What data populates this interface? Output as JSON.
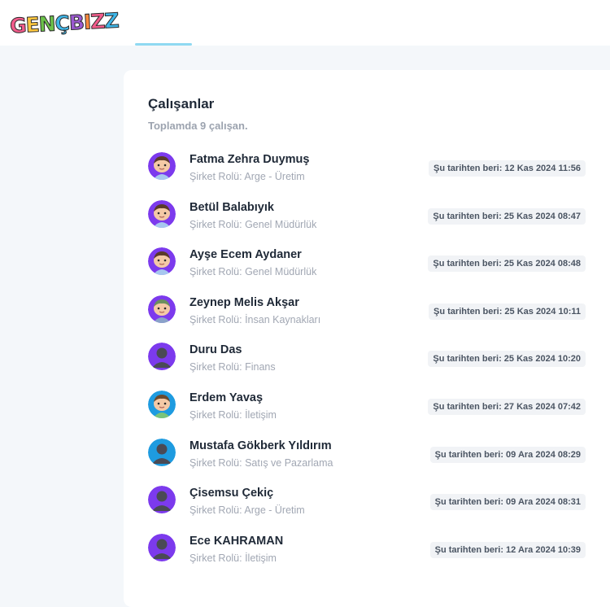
{
  "brand": {
    "logo_text": "GENÇBIZZ",
    "logo_colors": [
      "#f25c8b",
      "#ffc83d",
      "#6cc24a",
      "#3fb6e8",
      "#9b59d0",
      "#ff8a3d",
      "#f25c8b",
      "#3fb6e8"
    ]
  },
  "colors": {
    "page_bg": "#f4f7fa",
    "tab_accent": "#8fd9f2",
    "avatar_bg_purple": "#7c3aed",
    "avatar_bg_blue": "#1e9be0"
  },
  "employees": {
    "title": "Çalışanlar",
    "subtitle": "Toplamda 9 çalışan.",
    "items": [
      {
        "name": "Fatma Zehra Duymuş",
        "role": "Şirket Rolü: Arge - Üretim",
        "since": "Şu tarihten beri: 12 Kas 2024 11:56",
        "avatar": "girl-avatar-icon",
        "avatar_bg": "#7c3aed"
      },
      {
        "name": "Betül Balabıyık",
        "role": "Şirket Rolü: Genel Müdürlük",
        "since": "Şu tarihten beri: 25 Kas 2024 08:47",
        "avatar": "girl-avatar-icon",
        "avatar_bg": "#7c3aed"
      },
      {
        "name": "Ayşe Ecem Aydaner",
        "role": "Şirket Rolü: Genel Müdürlük",
        "since": "Şu tarihten beri: 25 Kas 2024 08:48",
        "avatar": "girl-avatar-icon",
        "avatar_bg": "#7c3aed"
      },
      {
        "name": "Zeynep Melis Akşar",
        "role": "Şirket Rolü: İnsan Kaynakları",
        "since": "Şu tarihten beri: 25 Kas 2024 10:11",
        "avatar": "cartoon-avatar-icon",
        "avatar_bg": "#7c3aed"
      },
      {
        "name": "Duru Das",
        "role": "Şirket Rolü: Finans",
        "since": "Şu tarihten beri: 25 Kas 2024 10:20",
        "avatar": "default-user-icon",
        "avatar_bg": "#7c3aed"
      },
      {
        "name": "Erdem Yavaş",
        "role": "Şirket Rolü: İletişim",
        "since": "Şu tarihten beri: 27 Kas 2024 07:42",
        "avatar": "boy-avatar-icon",
        "avatar_bg": "#1e9be0"
      },
      {
        "name": "Mustafa Gökberk Yıldırım",
        "role": "Şirket Rolü: Satış ve Pazarlama",
        "since": "Şu tarihten beri: 09 Ara 2024 08:29",
        "avatar": "default-user-icon",
        "avatar_bg": "#1e9be0"
      },
      {
        "name": "Çisemsu Çekiç",
        "role": "Şirket Rolü: Arge - Üretim",
        "since": "Şu tarihten beri: 09 Ara 2024 08:31",
        "avatar": "default-user-icon",
        "avatar_bg": "#7c3aed"
      },
      {
        "name": "Ece KAHRAMAN",
        "role": "Şirket Rolü: İletişim",
        "since": "Şu tarihten beri: 12 Ara 2024 10:39",
        "avatar": "default-user-icon",
        "avatar_bg": "#7c3aed"
      }
    ]
  }
}
